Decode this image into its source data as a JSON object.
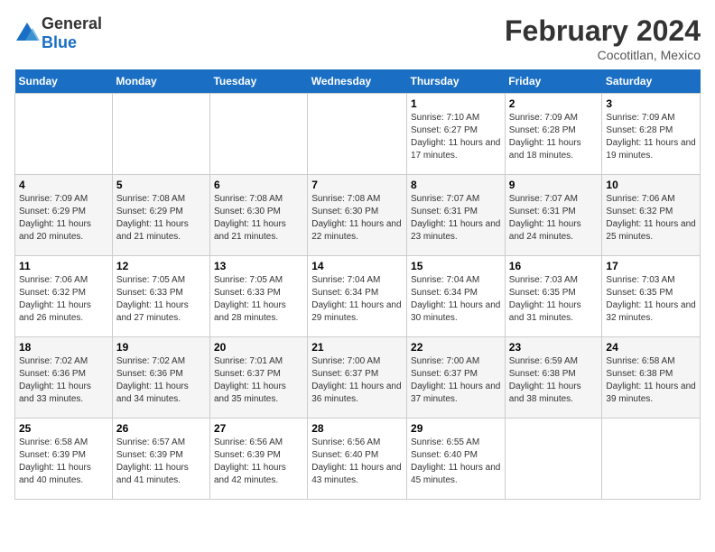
{
  "header": {
    "logo_general": "General",
    "logo_blue": "Blue",
    "month_year": "February 2024",
    "location": "Cocotitlan, Mexico"
  },
  "days_of_week": [
    "Sunday",
    "Monday",
    "Tuesday",
    "Wednesday",
    "Thursday",
    "Friday",
    "Saturday"
  ],
  "weeks": [
    [
      {
        "day": "",
        "info": ""
      },
      {
        "day": "",
        "info": ""
      },
      {
        "day": "",
        "info": ""
      },
      {
        "day": "",
        "info": ""
      },
      {
        "day": "1",
        "info": "Sunrise: 7:10 AM\nSunset: 6:27 PM\nDaylight: 11 hours and 17 minutes."
      },
      {
        "day": "2",
        "info": "Sunrise: 7:09 AM\nSunset: 6:28 PM\nDaylight: 11 hours and 18 minutes."
      },
      {
        "day": "3",
        "info": "Sunrise: 7:09 AM\nSunset: 6:28 PM\nDaylight: 11 hours and 19 minutes."
      }
    ],
    [
      {
        "day": "4",
        "info": "Sunrise: 7:09 AM\nSunset: 6:29 PM\nDaylight: 11 hours and 20 minutes."
      },
      {
        "day": "5",
        "info": "Sunrise: 7:08 AM\nSunset: 6:29 PM\nDaylight: 11 hours and 21 minutes."
      },
      {
        "day": "6",
        "info": "Sunrise: 7:08 AM\nSunset: 6:30 PM\nDaylight: 11 hours and 21 minutes."
      },
      {
        "day": "7",
        "info": "Sunrise: 7:08 AM\nSunset: 6:30 PM\nDaylight: 11 hours and 22 minutes."
      },
      {
        "day": "8",
        "info": "Sunrise: 7:07 AM\nSunset: 6:31 PM\nDaylight: 11 hours and 23 minutes."
      },
      {
        "day": "9",
        "info": "Sunrise: 7:07 AM\nSunset: 6:31 PM\nDaylight: 11 hours and 24 minutes."
      },
      {
        "day": "10",
        "info": "Sunrise: 7:06 AM\nSunset: 6:32 PM\nDaylight: 11 hours and 25 minutes."
      }
    ],
    [
      {
        "day": "11",
        "info": "Sunrise: 7:06 AM\nSunset: 6:32 PM\nDaylight: 11 hours and 26 minutes."
      },
      {
        "day": "12",
        "info": "Sunrise: 7:05 AM\nSunset: 6:33 PM\nDaylight: 11 hours and 27 minutes."
      },
      {
        "day": "13",
        "info": "Sunrise: 7:05 AM\nSunset: 6:33 PM\nDaylight: 11 hours and 28 minutes."
      },
      {
        "day": "14",
        "info": "Sunrise: 7:04 AM\nSunset: 6:34 PM\nDaylight: 11 hours and 29 minutes."
      },
      {
        "day": "15",
        "info": "Sunrise: 7:04 AM\nSunset: 6:34 PM\nDaylight: 11 hours and 30 minutes."
      },
      {
        "day": "16",
        "info": "Sunrise: 7:03 AM\nSunset: 6:35 PM\nDaylight: 11 hours and 31 minutes."
      },
      {
        "day": "17",
        "info": "Sunrise: 7:03 AM\nSunset: 6:35 PM\nDaylight: 11 hours and 32 minutes."
      }
    ],
    [
      {
        "day": "18",
        "info": "Sunrise: 7:02 AM\nSunset: 6:36 PM\nDaylight: 11 hours and 33 minutes."
      },
      {
        "day": "19",
        "info": "Sunrise: 7:02 AM\nSunset: 6:36 PM\nDaylight: 11 hours and 34 minutes."
      },
      {
        "day": "20",
        "info": "Sunrise: 7:01 AM\nSunset: 6:37 PM\nDaylight: 11 hours and 35 minutes."
      },
      {
        "day": "21",
        "info": "Sunrise: 7:00 AM\nSunset: 6:37 PM\nDaylight: 11 hours and 36 minutes."
      },
      {
        "day": "22",
        "info": "Sunrise: 7:00 AM\nSunset: 6:37 PM\nDaylight: 11 hours and 37 minutes."
      },
      {
        "day": "23",
        "info": "Sunrise: 6:59 AM\nSunset: 6:38 PM\nDaylight: 11 hours and 38 minutes."
      },
      {
        "day": "24",
        "info": "Sunrise: 6:58 AM\nSunset: 6:38 PM\nDaylight: 11 hours and 39 minutes."
      }
    ],
    [
      {
        "day": "25",
        "info": "Sunrise: 6:58 AM\nSunset: 6:39 PM\nDaylight: 11 hours and 40 minutes."
      },
      {
        "day": "26",
        "info": "Sunrise: 6:57 AM\nSunset: 6:39 PM\nDaylight: 11 hours and 41 minutes."
      },
      {
        "day": "27",
        "info": "Sunrise: 6:56 AM\nSunset: 6:39 PM\nDaylight: 11 hours and 42 minutes."
      },
      {
        "day": "28",
        "info": "Sunrise: 6:56 AM\nSunset: 6:40 PM\nDaylight: 11 hours and 43 minutes."
      },
      {
        "day": "29",
        "info": "Sunrise: 6:55 AM\nSunset: 6:40 PM\nDaylight: 11 hours and 45 minutes."
      },
      {
        "day": "",
        "info": ""
      },
      {
        "day": "",
        "info": ""
      }
    ]
  ]
}
